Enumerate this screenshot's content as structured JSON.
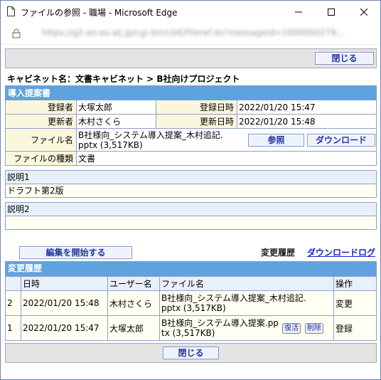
{
  "window": {
    "title": "ファイルの参照 - 職場 - Microsoft Edge",
    "url": "https://g2.eo.eo.aij.jp/cgi-bin/cb6/Fileref.do?messageid=1000000279..."
  },
  "toolbar": {
    "close_label": "閉じる"
  },
  "breadcrumb": "キャビネット名：文書キャビネット > B社向けプロジェクト",
  "doc": {
    "section_title": "導入提案書",
    "registrant_label": "登録者",
    "registrant": "大塚太郎",
    "registered_at_label": "登録日時",
    "registered_at": "2022/01/20 15:47",
    "updater_label": "更新者",
    "updater": "木村さくら",
    "updated_at_label": "更新日時",
    "updated_at": "2022/01/20 15:48",
    "filename_label": "ファイル名",
    "filename": "B社様向_システム導入提案_木村追記.pptx (3,517KB)",
    "browse_label": "参照",
    "download_label": "ダウンロード",
    "filetype_label": "ファイルの種類",
    "filetype": "文書"
  },
  "desc1": {
    "label": "説明1",
    "value": "ドラフト第2版"
  },
  "desc2": {
    "label": "説明2",
    "value": ""
  },
  "actions": {
    "edit_label": "編集を開始する",
    "history_label": "変更履歴",
    "download_log_label": "ダウンロードログ"
  },
  "history": {
    "title": "変更履歴",
    "columns": [
      "",
      "日時",
      "ユーザー名",
      "ファイル名",
      "操作"
    ],
    "rows": [
      {
        "no": "2",
        "datetime": "2022/01/20 15:48",
        "user": "木村さくら",
        "file": "B社様向_システム導入提案_木村追記.pptx (3,517KB)",
        "op": "変更"
      },
      {
        "no": "1",
        "datetime": "2022/01/20 15:47",
        "user": "大塚太郎",
        "file": "B社様向_システム導入提案.pptx (3,517KB)",
        "op": "登録",
        "restore": "復活",
        "delete": "削除"
      }
    ]
  },
  "footer": {
    "close_label": "閉じる"
  }
}
